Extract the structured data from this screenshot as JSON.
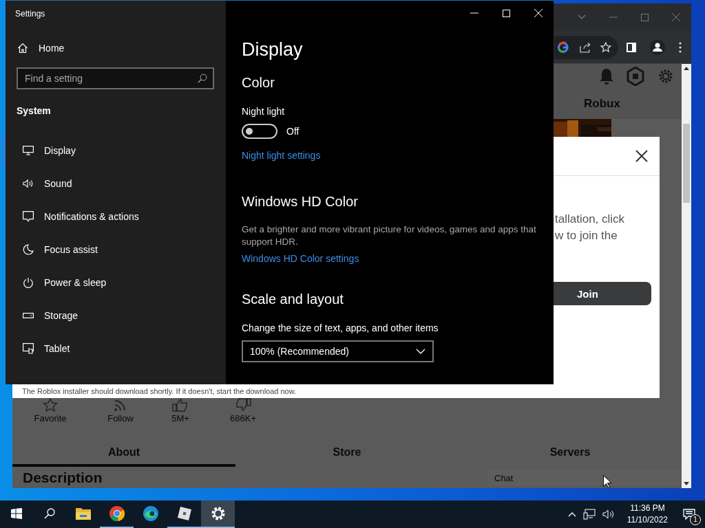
{
  "browser_window": {
    "header_link": "Robux",
    "modal": {
      "body_lines": [
        "tallation, click",
        "w to join the"
      ],
      "join_button": "Join",
      "footer_note": "The Roblox installer should download shortly. If it doesn't, start the download now."
    },
    "stats": [
      {
        "kind": "favorite",
        "label": "Favorite"
      },
      {
        "kind": "follow",
        "label": "Follow"
      },
      {
        "kind": "upvote",
        "label": "5M+"
      },
      {
        "kind": "downvote",
        "label": "686K+"
      }
    ],
    "tabs": [
      {
        "label": "About",
        "selected": true
      },
      {
        "label": "Store",
        "selected": false
      },
      {
        "label": "Servers",
        "selected": false
      }
    ],
    "section_title": "Description",
    "chat_placeholder": "Chat"
  },
  "settings_window": {
    "title": "Settings",
    "home": "Home",
    "search": {
      "placeholder": "Find a setting"
    },
    "group": "System",
    "nav_items": [
      {
        "kind": "display",
        "label": "Display",
        "selected": true
      },
      {
        "kind": "sound",
        "label": "Sound",
        "selected": false
      },
      {
        "kind": "notifications",
        "label": "Notifications & actions",
        "selected": false
      },
      {
        "kind": "focus",
        "label": "Focus assist",
        "selected": false
      },
      {
        "kind": "power",
        "label": "Power & sleep",
        "selected": false
      },
      {
        "kind": "storage",
        "label": "Storage",
        "selected": false
      },
      {
        "kind": "tablet",
        "label": "Tablet",
        "selected": false
      }
    ],
    "page_title": "Display",
    "color_heading": "Color",
    "night_light": {
      "label": "Night light",
      "on": false,
      "state_text": "Off"
    },
    "night_light_link": "Night light settings",
    "hd_heading": "Windows HD Color",
    "hd_description": "Get a brighter and more vibrant picture for videos, games and apps that support HDR.",
    "hd_link": "Windows HD Color settings",
    "scale_heading": "Scale and layout",
    "scale_label": "Change the size of text, apps, and other items",
    "scale_value": "100% (Recommended)"
  },
  "taskbar": {
    "apps": [
      {
        "kind": "explorer",
        "running": false,
        "selected": false
      },
      {
        "kind": "chrome",
        "running": true,
        "selected": false
      },
      {
        "kind": "edge",
        "running": false,
        "selected": false
      },
      {
        "kind": "roblox",
        "running": true,
        "selected": false
      },
      {
        "kind": "settings",
        "running": true,
        "selected": true
      }
    ],
    "time": "11:36 PM",
    "date": "11/10/2022",
    "notification_count": "1"
  }
}
